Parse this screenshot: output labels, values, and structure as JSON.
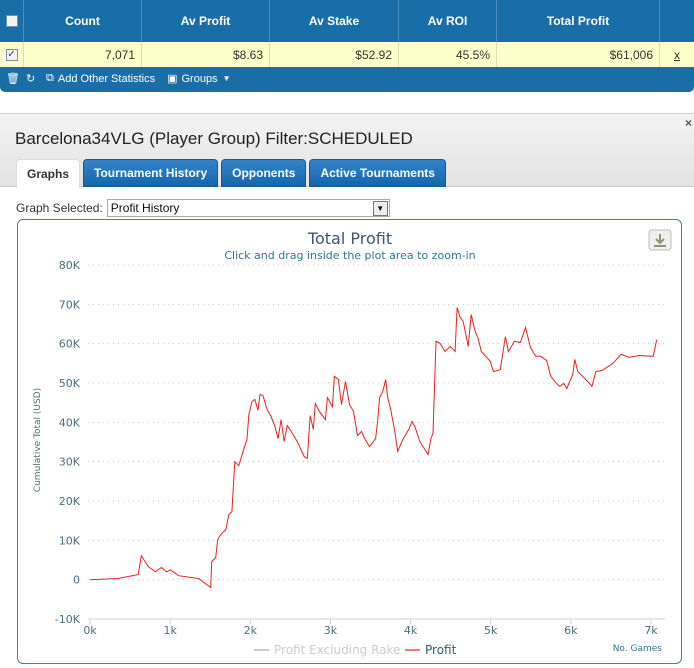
{
  "stats_table": {
    "headers": [
      "Count",
      "Av Profit",
      "Av Stake",
      "Av ROI",
      "Total Profit"
    ],
    "row": {
      "checked": true,
      "values": [
        "7,071",
        "$8.63",
        "$52.92",
        "45.5%",
        "$61,006"
      ],
      "remove_label": "x"
    },
    "toolbar": {
      "add_stats_label": "Add Other Statistics",
      "groups_label": "Groups"
    }
  },
  "panel": {
    "title": "Barcelona34VLG (Player Group) Filter:SCHEDULED",
    "close_glyph": "×",
    "tabs": [
      {
        "label": "Graphs",
        "active": true
      },
      {
        "label": "Tournament History",
        "active": false
      },
      {
        "label": "Opponents",
        "active": false
      },
      {
        "label": "Active Tournaments",
        "active": false
      }
    ],
    "graph_selected_label": "Graph Selected:",
    "graph_selected_value": "Profit History"
  },
  "chart_data": {
    "type": "line",
    "title": "Total Profit",
    "subtitle": "Click and drag inside the plot area to zoom-in",
    "xlabel": "No. Games",
    "ylabel": "Cumulative Total (USD)",
    "xlim": [
      0,
      7000
    ],
    "ylim": [
      -10000,
      80000
    ],
    "x_ticks": [
      "0k",
      "1k",
      "2k",
      "3k",
      "4k",
      "5k",
      "6k",
      "7k"
    ],
    "y_ticks": [
      "80K",
      "70K",
      "60K",
      "50K",
      "40K",
      "30K",
      "20K",
      "10K",
      "0",
      "-10K"
    ],
    "grid": true,
    "legend": [
      {
        "name": "Profit Excluding Rake",
        "color": "#cccccc",
        "visible": false
      },
      {
        "name": "Profit",
        "color": "#e8231f",
        "visible": true
      }
    ],
    "legend_position": "bottom",
    "series": [
      {
        "name": "Profit",
        "color": "#e8231f",
        "x": [
          0,
          351,
          477,
          602,
          640,
          728,
          816,
          891,
          954,
          1004,
          1104,
          1355,
          1506,
          1519,
          1569,
          1594,
          1632,
          1694,
          1732,
          1770,
          1807,
          1857,
          1920,
          1958,
          1983,
          2021,
          2058,
          2096,
          2121,
          2159,
          2209,
          2259,
          2309,
          2347,
          2385,
          2422,
          2460,
          2510,
          2585,
          2673,
          2711,
          2748,
          2786,
          2811,
          2861,
          2937,
          2962,
          3025,
          3050,
          3100,
          3138,
          3188,
          3238,
          3288,
          3338,
          3388,
          3426,
          3489,
          3564,
          3589,
          3614,
          3652,
          3690,
          3715,
          3752,
          3803,
          3840,
          3903,
          3978,
          4016,
          4054,
          4116,
          4179,
          4217,
          4254,
          4280,
          4317,
          4367,
          4430,
          4493,
          4556,
          4581,
          4618,
          4656,
          4719,
          4756,
          4807,
          4844,
          4882,
          4995,
          5033,
          5120,
          5183,
          5221,
          5296,
          5371,
          5434,
          5497,
          5560,
          5622,
          5698,
          5748,
          5811,
          5861,
          5911,
          5949,
          6024,
          6049,
          6087,
          6225,
          6262,
          6313,
          6388,
          6451,
          6526,
          6626,
          6727,
          6852,
          7028,
          7071
        ],
        "y": [
          0,
          300,
          800,
          1300,
          6100,
          3300,
          2000,
          3100,
          2000,
          2500,
          1000,
          300,
          -2000,
          4600,
          5600,
          10200,
          11500,
          12700,
          16500,
          17300,
          30000,
          29000,
          33300,
          35600,
          42000,
          45300,
          45800,
          43000,
          47100,
          46800,
          43300,
          41500,
          38900,
          35900,
          40700,
          35100,
          39200,
          37700,
          35100,
          31300,
          30800,
          41700,
          38200,
          44800,
          42800,
          40700,
          46300,
          44000,
          51700,
          50900,
          44500,
          50400,
          44500,
          42800,
          36600,
          37700,
          35900,
          33800,
          35900,
          40200,
          46300,
          47800,
          50900,
          46300,
          43300,
          37700,
          32600,
          35600,
          38200,
          40200,
          38900,
          35100,
          33100,
          31800,
          35900,
          37200,
          60600,
          60100,
          58000,
          59300,
          58000,
          69200,
          66700,
          65700,
          59300,
          67400,
          63100,
          61300,
          58000,
          55500,
          52900,
          53400,
          61800,
          58000,
          60600,
          60300,
          64100,
          59000,
          56800,
          56800,
          55700,
          51700,
          50100,
          49100,
          49900,
          48600,
          52200,
          56000,
          52900,
          50100,
          49100,
          52900,
          53200,
          54000,
          55000,
          57300,
          56500,
          57000,
          56800,
          61006
        ]
      }
    ]
  }
}
